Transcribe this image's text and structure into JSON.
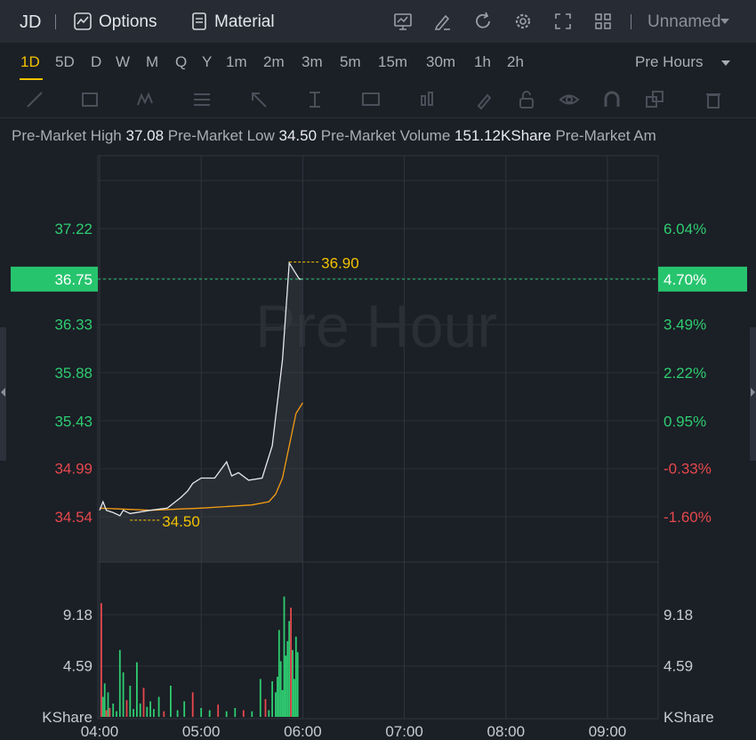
{
  "header": {
    "symbol": "JD",
    "options_label": "Options",
    "material_label": "Material",
    "layout_name": "Unnamed"
  },
  "timeframes": {
    "items": [
      "1D",
      "5D",
      "D",
      "W",
      "M",
      "Q",
      "Y",
      "1m",
      "2m",
      "3m",
      "5m",
      "15m",
      "30m",
      "1h",
      "2h"
    ],
    "active": "1D",
    "session": "Pre Hours"
  },
  "info": {
    "high_label": "Pre-Market High",
    "high_value": "37.08",
    "low_label": "Pre-Market Low",
    "low_value": "34.50",
    "volume_label": "Pre-Market Volume",
    "volume_value": "151.12KShare",
    "amount_label": "Pre-Market Am"
  },
  "colors": {
    "up": "#2ecc71",
    "down": "#e5484d",
    "price_line": "#e6e8ec",
    "avg_line": "#f39c12",
    "marker": "#f2c200",
    "current_badge": "#27c46e"
  },
  "chart_data": {
    "type": "line",
    "watermark": "Pre Hour",
    "x_ticks": [
      "04:00",
      "05:00",
      "06:00",
      "07:00",
      "08:00",
      "09:00"
    ],
    "price_ticks": [
      "37.22",
      "36.75",
      "36.33",
      "35.88",
      "35.43",
      "34.99",
      "34.54"
    ],
    "pct_ticks": [
      "6.04%",
      "4.70%",
      "3.49%",
      "2.22%",
      "0.95%",
      "-0.33%",
      "-1.60%"
    ],
    "price_range": [
      34.54,
      37.22
    ],
    "current_price": "36.75",
    "current_pct": "4.70%",
    "high_marker": "36.90",
    "low_marker": "34.50",
    "volume_ticks": [
      "9.18",
      "4.59"
    ],
    "volume_unit": "KShare",
    "price_series": {
      "time": [
        "04:00",
        "04:02",
        "04:04",
        "04:08",
        "04:12",
        "04:14",
        "04:18",
        "04:22",
        "04:30",
        "04:40",
        "04:48",
        "04:52",
        "04:55",
        "05:00",
        "05:08",
        "05:15",
        "05:18",
        "05:22",
        "05:28",
        "05:36",
        "05:42",
        "05:48",
        "05:52",
        "05:56",
        "05:58",
        "06:00"
      ],
      "price": [
        34.6,
        34.68,
        34.6,
        34.58,
        34.55,
        34.6,
        34.57,
        34.58,
        34.6,
        34.62,
        34.72,
        34.78,
        34.85,
        34.9,
        34.9,
        35.05,
        34.92,
        34.95,
        34.88,
        34.9,
        35.2,
        36.0,
        36.9,
        36.8,
        36.75,
        36.75
      ]
    },
    "avg_series": {
      "time": [
        "04:00",
        "04:30",
        "05:00",
        "05:30",
        "05:40",
        "05:44",
        "05:48",
        "05:52",
        "05:56",
        "06:00"
      ],
      "price": [
        34.62,
        34.6,
        34.62,
        34.65,
        34.68,
        34.75,
        34.9,
        35.2,
        35.5,
        35.6
      ]
    },
    "volume_series": {
      "time": [
        "04:01",
        "04:02",
        "04:03",
        "04:04",
        "04:05",
        "04:06",
        "04:08",
        "04:10",
        "04:12",
        "04:14",
        "04:16",
        "04:18",
        "04:20",
        "04:22",
        "04:24",
        "04:26",
        "04:28",
        "04:30",
        "04:32",
        "04:35",
        "04:38",
        "04:42",
        "04:46",
        "04:50",
        "04:55",
        "05:00",
        "05:05",
        "05:10",
        "05:15",
        "05:20",
        "05:25",
        "05:30",
        "05:35",
        "05:38",
        "05:40",
        "05:42",
        "05:44",
        "05:45",
        "05:46",
        "05:47",
        "05:48",
        "05:49",
        "05:50",
        "05:51",
        "05:52",
        "05:53",
        "05:54",
        "05:55",
        "05:56",
        "05:57"
      ],
      "volume": [
        10.2,
        1.8,
        3.0,
        0.6,
        2.2,
        0.8,
        1.2,
        0.5,
        6.0,
        4.0,
        1.5,
        2.8,
        0.7,
        4.9,
        1.2,
        2.6,
        0.9,
        1.4,
        0.7,
        1.8,
        0.5,
        2.8,
        0.6,
        1.4,
        2.2,
        0.8,
        0.6,
        1.1,
        0.5,
        0.8,
        0.6,
        0.5,
        3.4,
        1.6,
        0.6,
        3.2,
        2.2,
        3.6,
        7.8,
        5.0,
        2.4,
        10.8,
        5.5,
        6.8,
        8.6,
        9.8,
        6.0,
        3.4,
        7.2,
        5.8
      ],
      "up": [
        false,
        true,
        true,
        false,
        true,
        false,
        true,
        true,
        true,
        true,
        false,
        true,
        true,
        true,
        true,
        false,
        true,
        true,
        true,
        true,
        false,
        true,
        true,
        true,
        false,
        true,
        true,
        false,
        true,
        true,
        false,
        true,
        true,
        false,
        true,
        true,
        true,
        true,
        true,
        true,
        true,
        true,
        true,
        true,
        true,
        false,
        true,
        true,
        true,
        true
      ]
    }
  }
}
